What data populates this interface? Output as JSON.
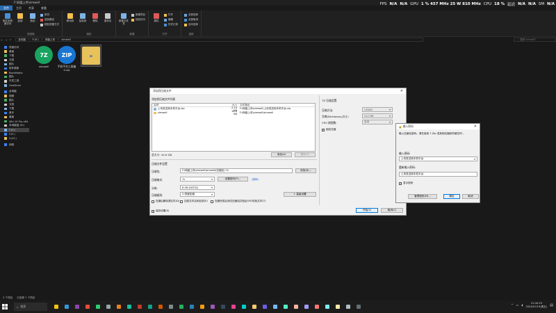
{
  "overlay": {
    "items": [
      {
        "label": "FPS",
        "value": "N/A"
      },
      {
        "label": "",
        "value": "N/A"
      },
      {
        "label": "GPU",
        "value": "1 %  457 MHz  25 W  810 MHz"
      },
      {
        "label": "CPU",
        "value": "18 %"
      },
      {
        "label": "延迟",
        "value": "N/A"
      },
      {
        "label": "",
        "value": "N/A"
      },
      {
        "label": "SM",
        "value": "N/A"
      }
    ]
  },
  "explorer": {
    "title": "F:\\网盘上传\\simwell",
    "ribbon_tabs": [
      "文件",
      "主页",
      "共享",
      "查看"
    ],
    "ribbon_groups": [
      {
        "label": "剪贴板",
        "buttons": [
          "固定到快速访问",
          "复制",
          "粘贴"
        ],
        "small": [
          "剪切",
          "复制路径",
          "粘贴快捷方式"
        ]
      },
      {
        "label": "组织",
        "buttons": [
          "移动到",
          "复制到",
          "删除",
          "重命名"
        ],
        "small": []
      },
      {
        "label": "新建",
        "buttons": [
          "新建文件夹"
        ],
        "small": [
          "新建项目",
          "轻松访问"
        ]
      },
      {
        "label": "打开",
        "buttons": [
          "属性"
        ],
        "small": [
          "打开",
          "编辑",
          "历史记录"
        ]
      },
      {
        "label": "选择",
        "buttons": [],
        "small": [
          "全部选择",
          "全部取消",
          "反向选择"
        ]
      }
    ],
    "breadcrumb": [
      "此电脑",
      "F:(E:)",
      "网盘上传",
      "simwell"
    ],
    "search_placeholder": "搜索\"simwell\"",
    "nav_items": [
      {
        "label": "快速访问",
        "head": true
      },
      {
        "label": "桌面"
      },
      {
        "label": "下载"
      },
      {
        "label": "文档"
      },
      {
        "label": "图片"
      },
      {
        "label": "软件更新"
      },
      {
        "label": "BackMedia"
      },
      {
        "label": "图片"
      },
      {
        "label": "开发工具"
      },
      {
        "label": "OneDrive"
      },
      {
        "label": "此电脑",
        "head": true
      },
      {
        "label": "视频"
      },
      {
        "label": "图片"
      },
      {
        "label": "文档"
      },
      {
        "label": "下载"
      },
      {
        "label": "音乐"
      },
      {
        "label": "桌面"
      },
      {
        "label": "Win 10 Pro x64"
      },
      {
        "label": "本地磁盘 (D:)"
      },
      {
        "label": "F:(E:)",
        "sel": true
      },
      {
        "label": "F:(F:)"
      },
      {
        "label": "G:(G:)"
      },
      {
        "label": "网络",
        "head": true
      }
    ],
    "files": [
      {
        "name": "simwell",
        "badge": "7Z",
        "color": "#1aa260"
      },
      {
        "name": "手机平台工具箱0.zip",
        "badge": "ZIP",
        "color": "#1976d2"
      },
      {
        "name": "",
        "badge": "»",
        "color": "#e8c15a"
      }
    ],
    "status": [
      "3 个项目",
      "已选择 1 个项目"
    ]
  },
  "dialog": {
    "title": "添加到压缩文件",
    "left_section_title": "添加到压缩文件列表",
    "table_headers": [
      "名称",
      "大小",
      "文件路径"
    ],
    "table_rows": [
      {
        "name": "上传发送到手机平台.zip",
        "size": "2.24 KB",
        "path": "F:\\网盘上传\\simwell\\上传发送到手机平台.zip"
      },
      {
        "name": "simwell",
        "size": "10.0 GB",
        "path": "F:\\网盘上传\\simwell\\simwell"
      }
    ],
    "total": "总大小: 10.0 GB",
    "btn_add": "添加(A)",
    "btn_remove": "删除(R)",
    "archive_section_title": "压缩文件设置",
    "archive_name_label": "压缩包:",
    "archive_name": "F:\\网盘上传\\simwell\\simwell(压缩包).7z",
    "btn_browse": "浏览(B)...",
    "format_label": "压缩格式:",
    "format_value": "7z",
    "btn_password": "设置密码(P)...",
    "password_link": "(密码)",
    "split_label": "分卷:",
    "split_value": "8 GB (FAT32)",
    "level_label": "压缩级别:",
    "level_value": "2-快速压缩",
    "btn_advanced": "+ 高级设置",
    "chk_delete": "压缩后删除源文件(D)",
    "chk_encrypt_names": "加密文件名和目录(E)",
    "chk_test": "压缩完成后测试压缩包并验证CRC校验文件(T)",
    "chk_save": "保存设置(S)",
    "btn_start": "开始(S)",
    "btn_cancel": "取消(C)",
    "right_section_title": "7Z 压缩设置",
    "method_label": "压缩方法:",
    "method_value": "LZMA2",
    "dict_label": "字典(Dictionary)大小:",
    "dict_value": "512 MB",
    "cpu_label": "CPU 线程数:",
    "cpu_value": "自动",
    "chk_solid": "固实压缩"
  },
  "password_dialog": {
    "title": "输入密码",
    "message": "输入压缩包密码。请在使用 7-Zip 或其他压缩软件解压时…",
    "pw_label": "输入密码:",
    "pw_value": "上传发送到手机平台",
    "confirm_label": "重新输入密码:",
    "confirm_value": "上传发送到手机平台",
    "chk_show": "显示密码",
    "btn_manage": "管理密码(M)...",
    "btn_ok": "确定",
    "btn_cancel": "取消"
  },
  "taskbar": {
    "search_placeholder": "搜索",
    "apps": [
      "#f1c40f",
      "#3498db",
      "#8e44ad",
      "#e74c3c",
      "#2ecc71",
      "#95a5a6",
      "#e67e22",
      "#1abc9c",
      "#c0392b",
      "#16a085",
      "#d35400",
      "#7f8c8d",
      "#27ae60",
      "#2980b9",
      "#f39c12",
      "#9b59b6",
      "#34495e",
      "#e84393",
      "#00cec9",
      "#fdcb6e",
      "#6c5ce7",
      "#74b9ff",
      "#55efc4",
      "#fab1a0",
      "#a29bfe",
      "#ff7675",
      "#81ecec",
      "#ffeaa7",
      "#b2bec3",
      "#636e72"
    ],
    "time": "21:44:19",
    "date": "2024/07/19(周五)"
  }
}
